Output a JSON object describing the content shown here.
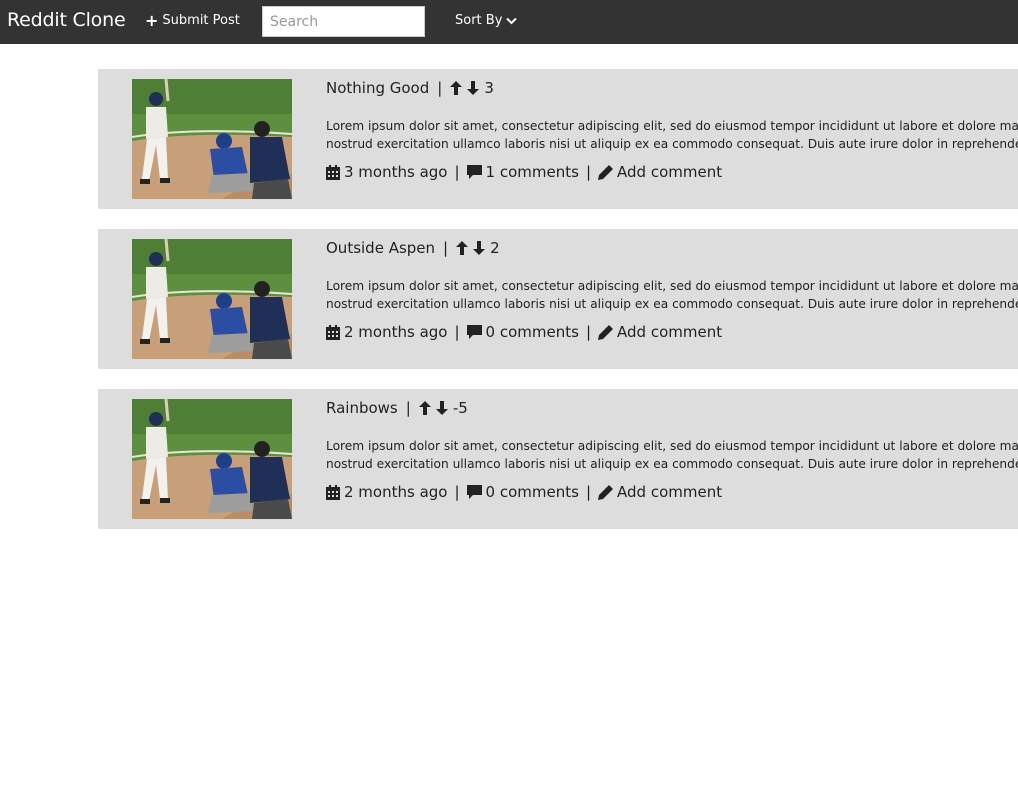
{
  "navbar": {
    "brand": "Reddit Clone",
    "submit_label": "Submit Post",
    "search_placeholder": "Search",
    "sort_label": "Sort By"
  },
  "posts": [
    {
      "title": "Nothing Good",
      "score": "3",
      "body_line1": "Lorem ipsum dolor sit amet, consectetur adipiscing elit, sed do eiusmod tempor incididunt ut labore et dolore magna aliqua. Ut enim ad minim veniam, quis",
      "body_line2": "nostrud exercitation ullamco laboris nisi ut aliquip ex ea commodo consequat. Duis aute irure dolor in reprehenderit in voluptate velit esse cillum dolore",
      "time": "3 months ago",
      "comments": "1 comments",
      "add_comment": "Add comment"
    },
    {
      "title": "Outside Aspen",
      "score": "2",
      "body_line1": "Lorem ipsum dolor sit amet, consectetur adipiscing elit, sed do eiusmod tempor incididunt ut labore et dolore magna aliqua. Ut enim ad minim veniam, quis",
      "body_line2": "nostrud exercitation ullamco laboris nisi ut aliquip ex ea commodo consequat. Duis aute irure dolor in reprehenderit in voluptate velit esse cillum dolore",
      "time": "2 months ago",
      "comments": "0 comments",
      "add_comment": "Add comment"
    },
    {
      "title": "Rainbows",
      "score": "-5",
      "body_line1": "Lorem ipsum dolor sit amet, consectetur adipiscing elit, sed do eiusmod tempor incididunt ut labore et dolore magna aliqua. Ut enim ad minim veniam, quis",
      "body_line2": "nostrud exercitation ullamco laboris nisi ut aliquip ex ea commodo consequat. Duis aute irure dolor in reprehenderit in voluptate velit esse cillum dolore",
      "time": "2 months ago",
      "comments": "0 comments",
      "add_comment": "Add comment"
    }
  ]
}
